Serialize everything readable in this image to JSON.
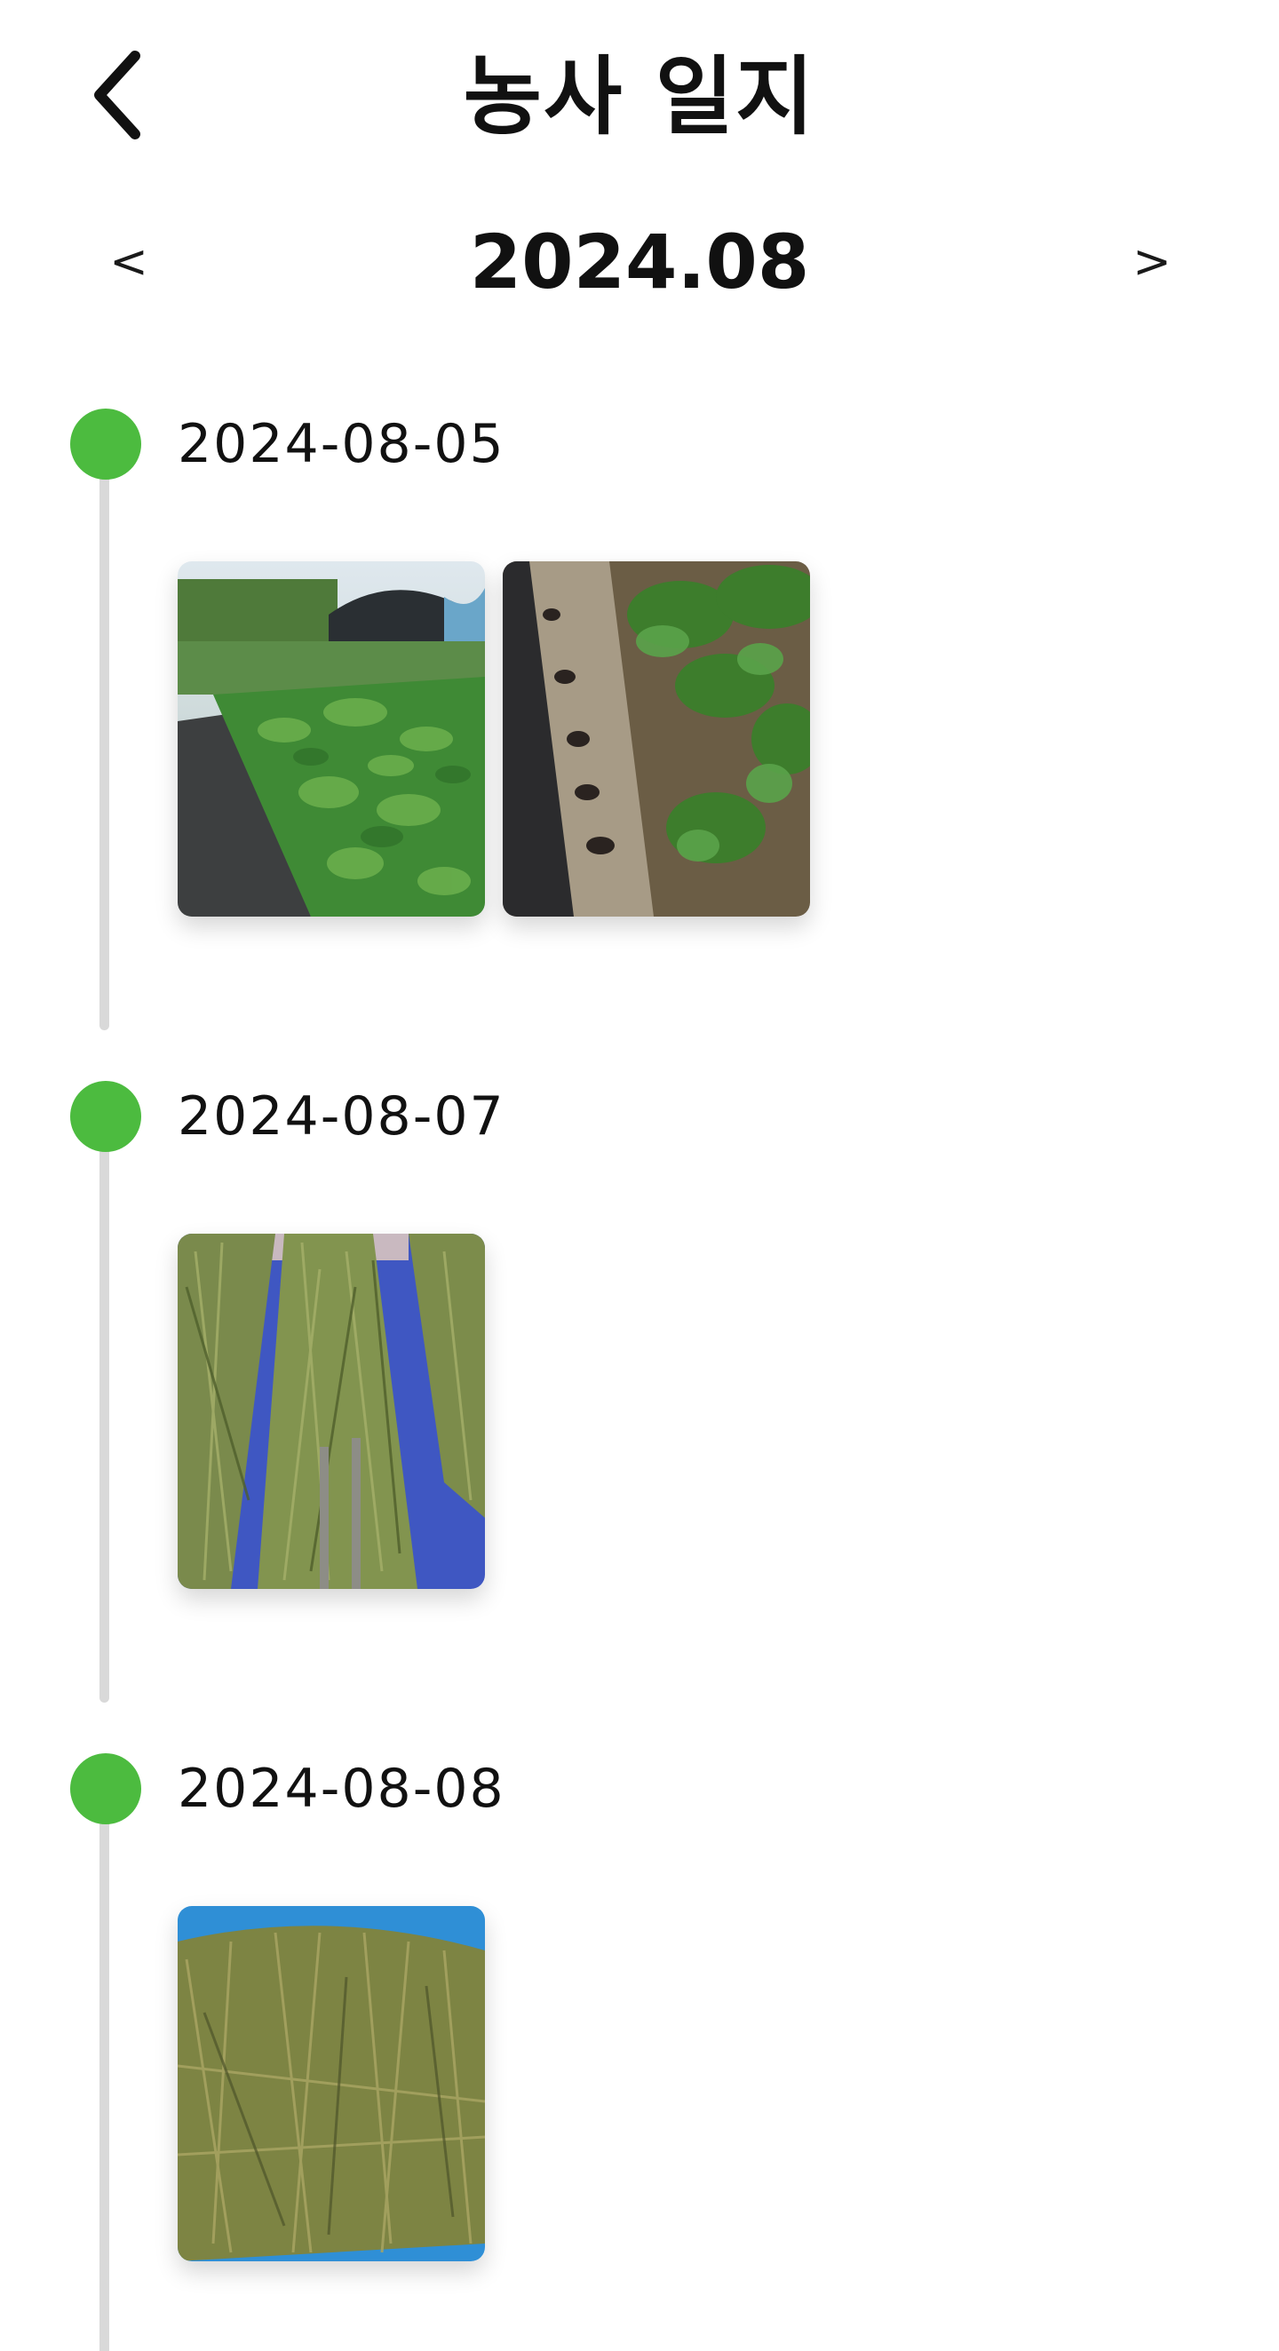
{
  "header": {
    "back_icon": "chevron-left-icon",
    "title": "농사 일지"
  },
  "month_nav": {
    "prev_label": "<",
    "month": "2024.08",
    "next_label": ">"
  },
  "entries": [
    {
      "date": "2024-08-05",
      "photos": [
        {
          "subject": "greenhouse field with crops"
        },
        {
          "subject": "cucumber vines over mulch film"
        }
      ]
    },
    {
      "date": "2024-08-07",
      "photos": [
        {
          "subject": "harvested plants drying on blue tarp"
        }
      ]
    },
    {
      "date": "2024-08-08",
      "photos": [
        {
          "subject": "pile of dried plants on blue tarp"
        }
      ]
    }
  ],
  "colors": {
    "accent": "#4cbb3f",
    "timeline_line": "#d9d9d9",
    "text": "#111111"
  }
}
